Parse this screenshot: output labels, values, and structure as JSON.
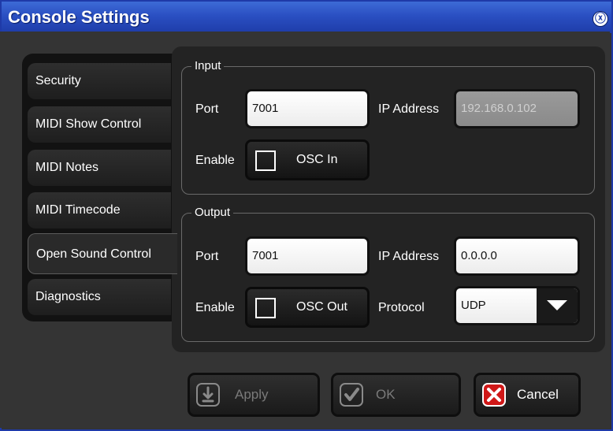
{
  "window": {
    "title": "Console Settings",
    "close_icon": "ⓧ"
  },
  "tabs": [
    {
      "label": "Security"
    },
    {
      "label": "MIDI Show Control"
    },
    {
      "label": "MIDI Notes"
    },
    {
      "label": "MIDI Timecode"
    },
    {
      "label": "Open Sound Control",
      "active": true
    },
    {
      "label": "Diagnostics"
    }
  ],
  "input": {
    "group_label": "Input",
    "port_label": "Port",
    "port_value": "7001",
    "ip_label": "IP Address",
    "ip_value": "192.168.0.102",
    "enable_label": "Enable",
    "toggle_label": "OSC In"
  },
  "output": {
    "group_label": "Output",
    "port_label": "Port",
    "port_value": "7001",
    "ip_label": "IP Address",
    "ip_value": "0.0.0.0",
    "enable_label": "Enable",
    "toggle_label": "OSC Out",
    "protocol_label": "Protocol",
    "protocol_value": "UDP"
  },
  "buttons": {
    "apply": "Apply",
    "ok": "OK",
    "cancel": "Cancel"
  },
  "colors": {
    "titlebar": "#2a4fc2",
    "cancel_icon": "#d01818"
  }
}
